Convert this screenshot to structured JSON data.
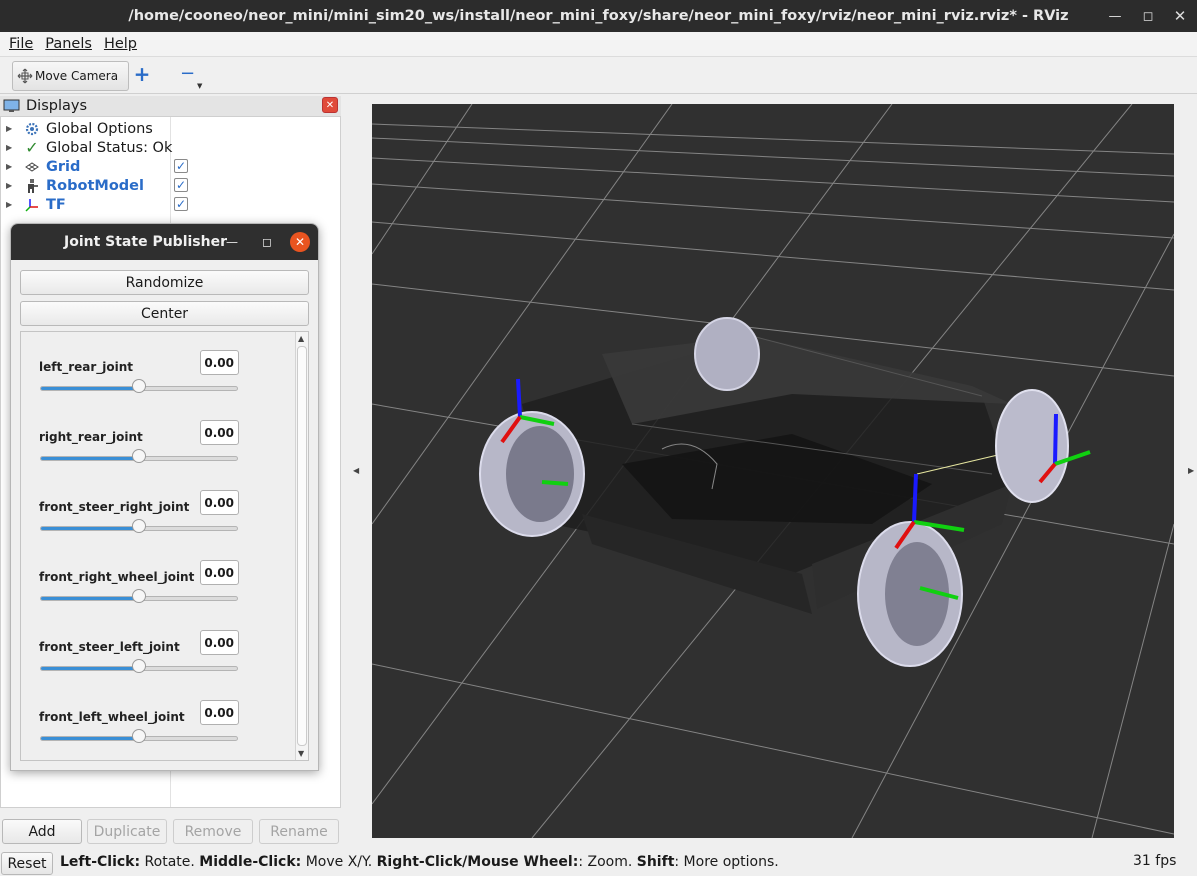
{
  "window": {
    "title": "/home/cooneo/neor_mini/mini_sim20_ws/install/neor_mini_foxy/share/neor_mini_foxy/rviz/neor_mini_rviz.rviz* - RViz"
  },
  "menu": {
    "file": "File",
    "panels": "Panels",
    "help": "Help"
  },
  "toolbar": {
    "move_camera": "Move Camera",
    "add": "+",
    "remove": "−"
  },
  "displays": {
    "title": "Displays",
    "items": [
      {
        "label": "Global Options",
        "icon": "gear-icon",
        "checked": null
      },
      {
        "label": "Global Status: Ok",
        "icon": "check-icon",
        "checked": null
      },
      {
        "label": "Grid",
        "icon": "grid-icon",
        "checked": true
      },
      {
        "label": "RobotModel",
        "icon": "robot-icon",
        "checked": true
      },
      {
        "label": "TF",
        "icon": "axes-icon",
        "checked": true
      }
    ],
    "buttons": {
      "add": "Add",
      "duplicate": "Duplicate",
      "remove": "Remove",
      "rename": "Rename"
    }
  },
  "joint_state_publisher": {
    "title": "Joint State Publisher",
    "randomize": "Randomize",
    "center": "Center",
    "joints": [
      {
        "name": "left_rear_joint",
        "value": "0.00",
        "position": 0.5
      },
      {
        "name": "right_rear_joint",
        "value": "0.00",
        "position": 0.5
      },
      {
        "name": "front_steer_right_joint",
        "value": "0.00",
        "position": 0.5
      },
      {
        "name": "front_right_wheel_joint",
        "value": "0.00",
        "position": 0.5
      },
      {
        "name": "front_steer_left_joint",
        "value": "0.00",
        "position": 0.5
      },
      {
        "name": "front_left_wheel_joint",
        "value": "0.00",
        "position": 0.5
      }
    ]
  },
  "status": {
    "reset": "Reset",
    "hint_parts": [
      {
        "bold": true,
        "text": "Left-Click:"
      },
      {
        "bold": false,
        "text": " Rotate. "
      },
      {
        "bold": true,
        "text": "Middle-Click:"
      },
      {
        "bold": false,
        "text": " Move X/Y. "
      },
      {
        "bold": true,
        "text": "Right-Click/Mouse Wheel:"
      },
      {
        "bold": false,
        "text": ": Zoom. "
      },
      {
        "bold": true,
        "text": "Shift"
      },
      {
        "bold": false,
        "text": ": More options."
      }
    ],
    "fps": "31 fps"
  },
  "colors": {
    "accent": "#2a6cc8",
    "slider_fill": "#3a8fd6",
    "close_orange": "#e95420",
    "viewport_bg": "#303030",
    "axis_x": "#e01010",
    "axis_y": "#10d010",
    "axis_z": "#1a1aff"
  }
}
